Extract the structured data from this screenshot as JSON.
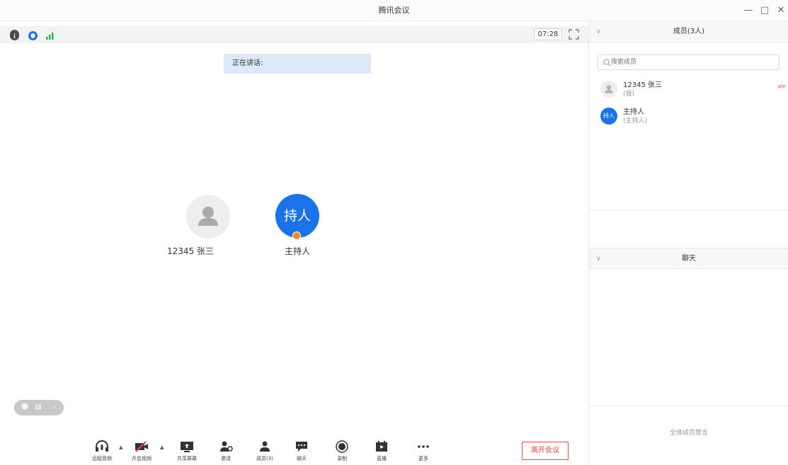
{
  "window": {
    "title": "腾讯会议"
  },
  "topbar": {
    "timer": "07:28"
  },
  "meeting": {
    "speaking_label": "正在讲话:"
  },
  "participants": [
    {
      "name": "12345 张三"
    },
    {
      "name": "主持人",
      "avatar_text": "持人"
    }
  ],
  "toolbar": {
    "items": [
      {
        "label": "远程音频",
        "icon": "headphones-icon"
      },
      {
        "label": "开启视频",
        "icon": "video-off-icon"
      },
      {
        "label": "共享屏幕",
        "icon": "share-screen-icon"
      },
      {
        "label": "邀请",
        "icon": "invite-icon"
      },
      {
        "label": "成员(3)",
        "icon": "members-icon"
      },
      {
        "label": "聊天",
        "icon": "chat-icon"
      },
      {
        "label": "录制",
        "icon": "record-icon"
      },
      {
        "label": "直播",
        "icon": "live-icon"
      },
      {
        "label": "更多",
        "icon": "more-icon"
      }
    ],
    "leave_label": "离开会议"
  },
  "members_panel": {
    "title": "成员(3人)",
    "search_placeholder": "搜索成员",
    "members": [
      {
        "name": "12345 张三",
        "role": "(我)",
        "tag": "pin"
      },
      {
        "name": "主持人",
        "role": "(主持人)",
        "avatar_text": "持人"
      }
    ]
  },
  "chat_panel": {
    "title": "聊天",
    "footer": "全体成员禁言"
  },
  "colors": {
    "accent": "#1a73e8",
    "danger": "#e0474c",
    "host_badge": "#f08a24",
    "signal": "#2fb344"
  }
}
